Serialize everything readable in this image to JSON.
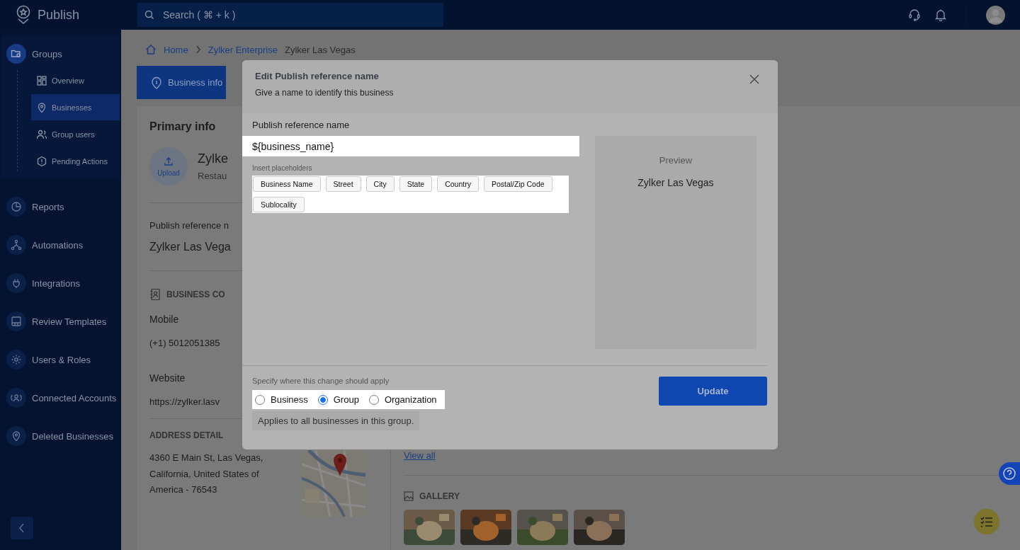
{
  "topbar": {
    "app_name": "Publish",
    "search": {
      "placeholder": "Search ( ⌘ + k )"
    }
  },
  "sidebar": {
    "items": [
      {
        "label": "Groups",
        "selected": true,
        "expanded": true,
        "children": [
          {
            "label": "Overview",
            "selected": false
          },
          {
            "label": "Businesses",
            "selected": true
          },
          {
            "label": "Group users",
            "selected": false
          },
          {
            "label": "Pending Actions",
            "selected": false
          }
        ]
      },
      {
        "label": "Reports",
        "selected": false
      },
      {
        "label": "Automations",
        "selected": false
      },
      {
        "label": "Integrations",
        "selected": false
      },
      {
        "label": "Review Templates",
        "selected": false
      },
      {
        "label": "Users & Roles",
        "selected": false
      },
      {
        "label": "Connected Accounts",
        "selected": false
      },
      {
        "label": "Deleted Businesses",
        "selected": false
      }
    ]
  },
  "breadcrumb": {
    "home": "Home",
    "links": [
      "Zylker Enterprise"
    ],
    "current": "Zylker Las Vegas"
  },
  "tabs": [
    {
      "label": "Business info",
      "selected": true
    }
  ],
  "business": {
    "section_title": "Primary info",
    "upload": "Upload",
    "name": "Zylke",
    "category": "Restau",
    "reference_label": "Publish reference n",
    "reference_value": "Zylker Las Vega",
    "contact_heading": "BUSINESS CO",
    "mobile_label": "Mobile",
    "mobile": "(+1) 5012051385",
    "website_label": "Website",
    "website": "https://zylker.lasv",
    "address_heading": "ADDRESS DETAIL",
    "address": "4360 E Main St, Las Vegas, California, United States of America - 76543",
    "view_all": "View all",
    "gallery_heading": "GALLERY"
  },
  "dialog": {
    "title": "Edit Publish reference name",
    "subtitle": "Give a name to identify this business",
    "field": {
      "label": "Publish reference name",
      "value": "${business_name}"
    },
    "placeholders_label": "Insert placeholders",
    "placeholders": [
      "Business Name",
      "Street",
      "City",
      "State",
      "Country",
      "Postal/Zip Code",
      "Sublocality"
    ],
    "preview": {
      "label": "Preview",
      "value": "Zylker Las Vegas"
    },
    "scope_label": "Specify where this change should apply",
    "scopes": [
      {
        "label": "Business",
        "selected": false
      },
      {
        "label": "Group",
        "selected": true
      },
      {
        "label": "Organization",
        "selected": false
      }
    ],
    "scope_hint": "Applies to all businesses in this group.",
    "update_button": "Update"
  }
}
